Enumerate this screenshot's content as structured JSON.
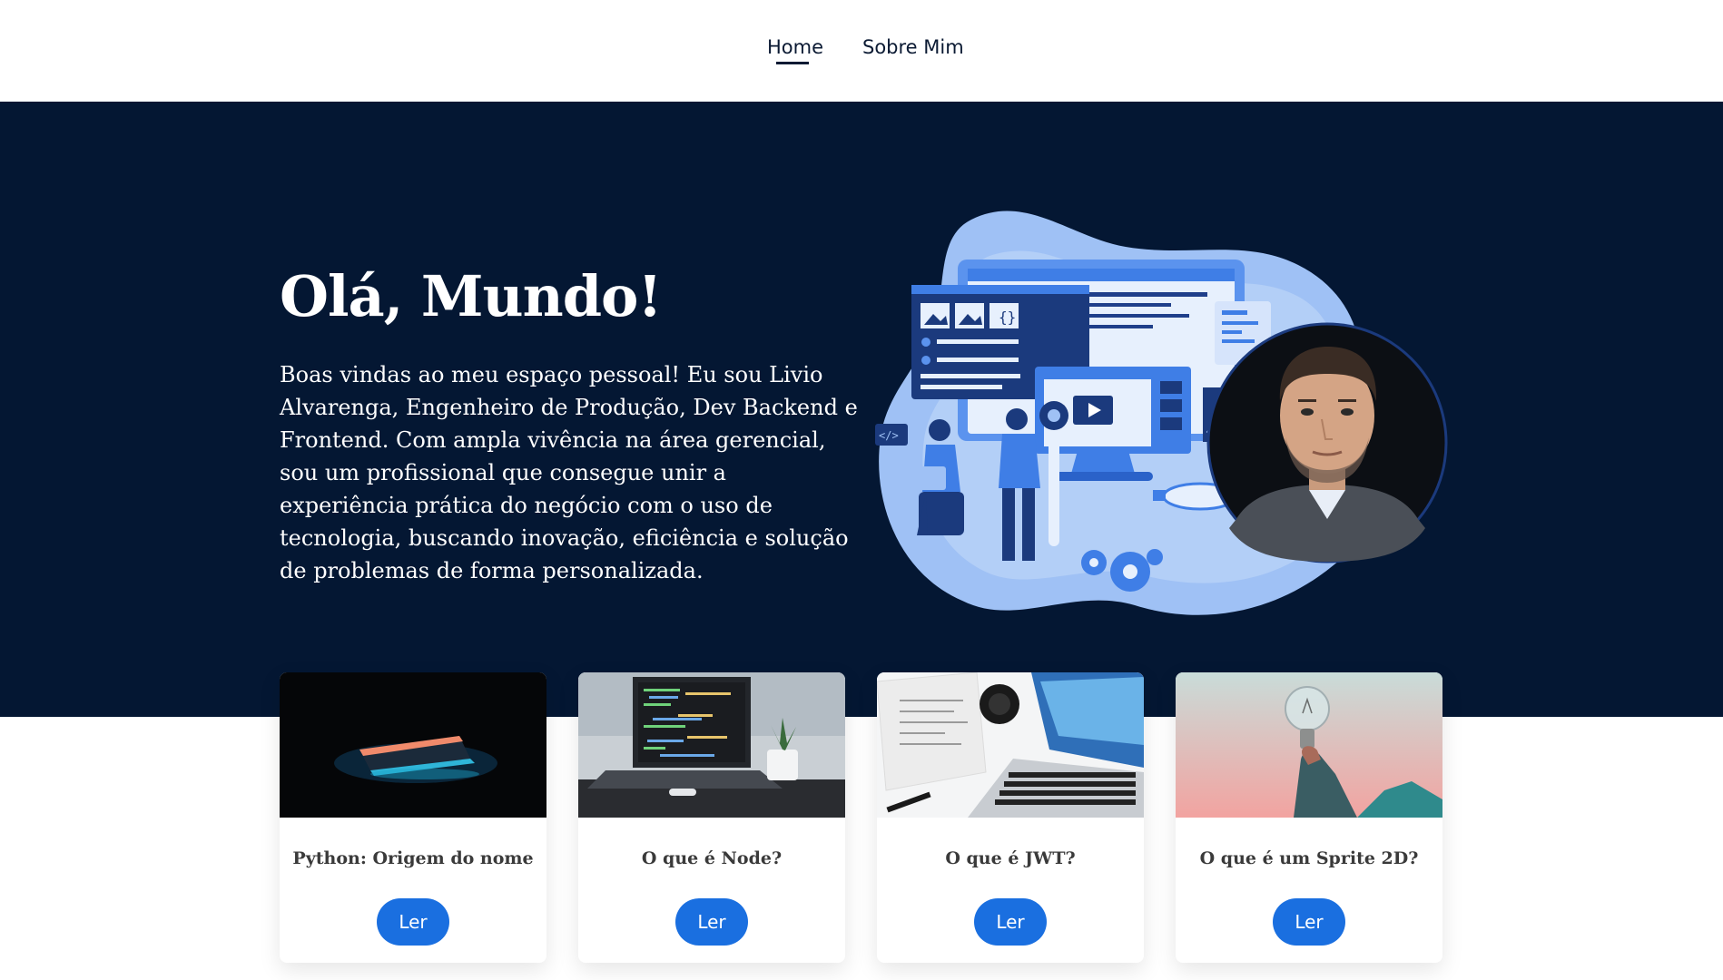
{
  "nav": {
    "items": [
      {
        "label": "Home",
        "active": true
      },
      {
        "label": "Sobre Mim",
        "active": false
      }
    ]
  },
  "hero": {
    "title": "Olá, Mundo!",
    "text": "Boas vindas ao meu espaço pessoal! Eu sou Livio Alvarenga, Engenheiro de Produção, Dev Backend e Frontend. Com ampla vivência na área gerencial, sou um profissional que consegue unir a experiência prática do negócio com o uso de tecnologia, buscando inovação, eficiência e solução de problemas de forma personalizada."
  },
  "cards": [
    {
      "title": "Python: Origem do nome",
      "button": "Ler",
      "image": "laptop-neon-image"
    },
    {
      "title": "O que é Node?",
      "button": "Ler",
      "image": "laptop-code-image"
    },
    {
      "title": "O que é JWT?",
      "button": "Ler",
      "image": "laptop-desk-image"
    },
    {
      "title": "O que é um Sprite 2D?",
      "button": "Ler",
      "image": "lightbulb-image"
    }
  ],
  "colors": {
    "hero_bg": "#041733",
    "accent": "#1a6fe0",
    "nav_text": "#0b1a33"
  }
}
